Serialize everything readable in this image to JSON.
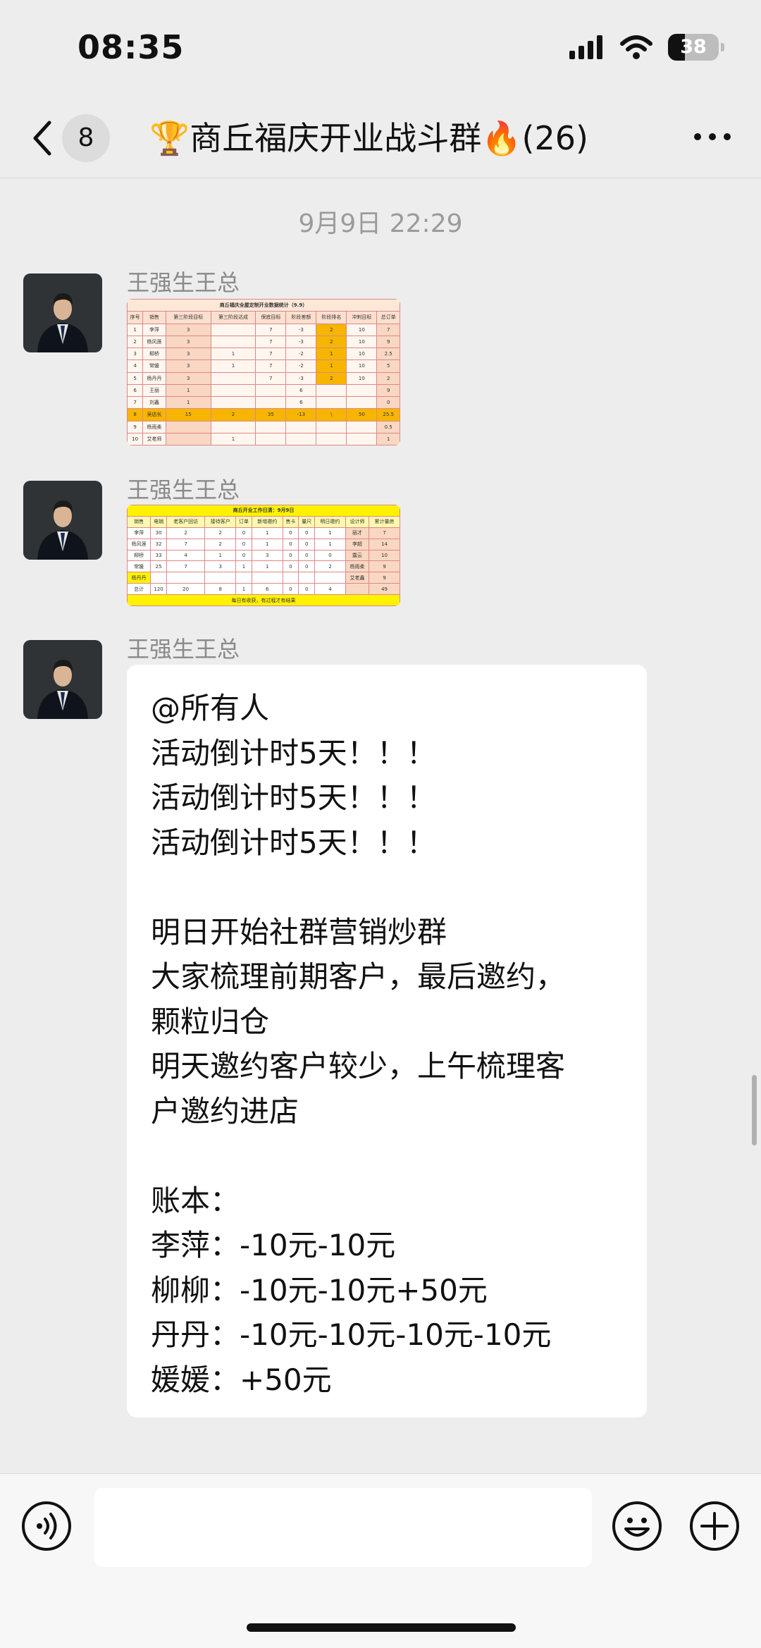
{
  "status_bar": {
    "time": "08:35",
    "battery": "38"
  },
  "nav": {
    "unread_count": "8",
    "title": "🏆商丘福庆开业战斗群🔥(26)"
  },
  "timestamp": "9月9日 22:29",
  "messages": [
    {
      "sender": "王强生王总",
      "type": "image",
      "image": {
        "title": "商丘福庆全屋定制开业数据统计（9.9）",
        "headers": [
          "序号",
          "销售",
          "第三阶段目标",
          "第三阶段达成",
          "保底目标",
          "阶段差额",
          "阶段排名",
          "冲刺目标",
          "总订单"
        ],
        "rows": [
          [
            "1",
            "李萍",
            "3",
            "",
            "7",
            "-3",
            "2",
            "10",
            "7"
          ],
          [
            "2",
            "杨风莲",
            "3",
            "",
            "7",
            "-3",
            "2",
            "10",
            "9"
          ],
          [
            "3",
            "柳桥",
            "3",
            "1",
            "7",
            "-2",
            "1",
            "10",
            "2.5"
          ],
          [
            "4",
            "常媛",
            "3",
            "1",
            "7",
            "-2",
            "1",
            "10",
            "5"
          ],
          [
            "5",
            "杨丹丹",
            "3",
            "",
            "7",
            "-3",
            "2",
            "10",
            "2"
          ],
          [
            "6",
            "王丽",
            "1",
            "",
            "",
            "6",
            "",
            "",
            "9"
          ],
          [
            "7",
            "刘鑫",
            "1",
            "",
            "",
            "6",
            "",
            "",
            "0"
          ],
          [
            "8",
            "吴店长",
            "15",
            "2",
            "35",
            "-13",
            "\\",
            "50",
            "25.5"
          ],
          [
            "9",
            "杨雨柔",
            "",
            "",
            "",
            "",
            "",
            "",
            "0.5"
          ],
          [
            "10",
            "艾老师",
            "",
            "1",
            "",
            "",
            "",
            "",
            "1"
          ]
        ]
      }
    },
    {
      "sender": "王强生王总",
      "type": "image",
      "image": {
        "title": "商丘开业工作日清：9月9日",
        "headers": [
          "销售",
          "电销",
          "老客户回访",
          "接待客户",
          "订单",
          "新增邀约",
          "售卡",
          "量尺",
          "明日邀约",
          "设计师",
          "累计量房"
        ],
        "rows": [
          [
            "李萍",
            "30",
            "2",
            "2",
            "0",
            "1",
            "0",
            "0",
            "1",
            "丽才",
            "7"
          ],
          [
            "杨风莲",
            "32",
            "7",
            "2",
            "0",
            "1",
            "0",
            "0",
            "1",
            "李超",
            "14"
          ],
          [
            "柳桥",
            "33",
            "4",
            "1",
            "0",
            "3",
            "0",
            "0",
            "0",
            "露云",
            "10"
          ],
          [
            "常媛",
            "25",
            "7",
            "3",
            "1",
            "1",
            "0",
            "0",
            "2",
            "杨雨柔",
            "9"
          ],
          [
            "杨丹丹",
            "",
            "",
            "",
            "",
            "",
            "",
            "",
            "",
            "艾老鑫",
            "9"
          ],
          [
            "总计",
            "120",
            "20",
            "8",
            "1",
            "6",
            "0",
            "0",
            "4",
            "",
            "49"
          ]
        ],
        "footer": "每日有收获，有过程才有结果"
      }
    },
    {
      "sender": "王强生王总",
      "type": "text",
      "lines": [
        "@所有人",
        "活动倒计时5天！！！",
        "活动倒计时5天！！！",
        "活动倒计时5天！！！",
        "",
        "明日开始社群营销炒群",
        "大家梳理前期客户，最后邀约，",
        "颗粒归仓",
        "明天邀约客户较少，上午梳理客",
        "户邀约进店",
        "",
        "账本：",
        "李萍：-10元-10元",
        "柳柳：-10元-10元+50元",
        "丹丹：-10元-10元-10元-10元",
        "媛媛：+50元"
      ]
    }
  ],
  "icons": {
    "back": "chevron-left-icon",
    "more": "more-icon",
    "voice": "voice-icon",
    "emoji": "emoji-icon",
    "plus": "plus-icon",
    "signal": "signal-icon",
    "wifi": "wifi-icon",
    "battery": "battery-icon"
  },
  "colors": {
    "background": "#EDEDED",
    "bubble": "#FFFFFF",
    "sheet_orange": "#F7B500",
    "sheet_peach": "#F9D7C2",
    "sheet_yellow": "#FFF200"
  }
}
